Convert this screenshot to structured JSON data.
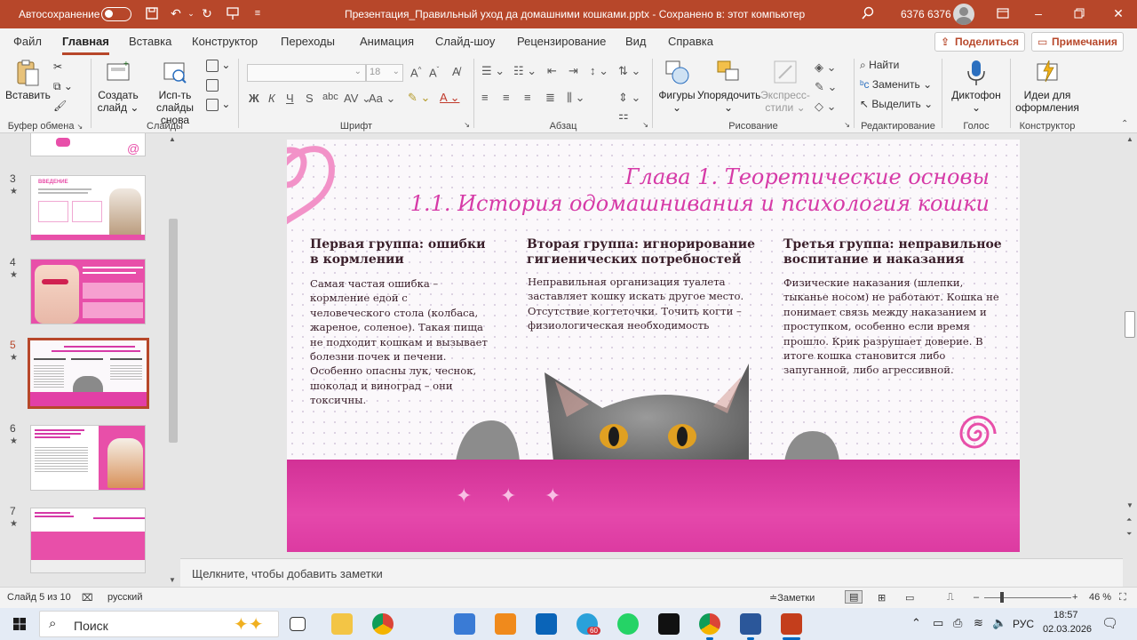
{
  "titlebar": {
    "autosave_label": "Автосохранение",
    "title": "Презентация_Правильный уход да домашними кошками.pptx  -  Сохранено в: этот компьютер ",
    "user_name": "6376 6376"
  },
  "tabs": [
    "Файл",
    "Главная",
    "Вставка",
    "Конструктор",
    "Переходы",
    "Анимация",
    "Слайд-шоу",
    "Рецензирование",
    "Вид",
    "Справка"
  ],
  "share": {
    "share_label": "Поделиться",
    "comments_label": "Примечания"
  },
  "ribbon": {
    "clipboard": {
      "paste": "Вставить",
      "group": "Буфер обмена"
    },
    "slides": {
      "new_slide_1": "Создать",
      "new_slide_2": "слайд",
      "reuse_1": "Исп-ть",
      "reuse_2": "слайды снова",
      "group": "Слайды"
    },
    "font": {
      "size": "18",
      "group": "Шрифт",
      "bold": "Ж",
      "italic": "К",
      "underline": "Ч",
      "strike": "S",
      "shadow": "abc"
    },
    "paragraph": {
      "group": "Абзац"
    },
    "drawing": {
      "shapes": "Фигуры",
      "arrange": "Упорядочить",
      "quick_1": "Экспресс-",
      "quick_2": "стили",
      "group": "Рисование"
    },
    "editing": {
      "find": "Найти",
      "replace": "Заменить",
      "select": "Выделить",
      "group": "Редактирование"
    },
    "voice": {
      "dictate": "Диктофон",
      "group": "Голос"
    },
    "designer": {
      "ideas_1": "Идеи для",
      "ideas_2": "оформления",
      "group": "Конструктор"
    }
  },
  "thumbnails": [
    {
      "num": "3",
      "star": "★"
    },
    {
      "num": "4",
      "star": "★"
    },
    {
      "num": "5",
      "star": "★"
    },
    {
      "num": "6",
      "star": "★"
    },
    {
      "num": "7",
      "star": "★"
    }
  ],
  "slide": {
    "title_line1": "Глава 1. Теоретические основы",
    "title_line2": "1.1. История одомашнивания и психология кошки",
    "col1": {
      "heading": "Первая группа: ошибки в кормлении",
      "text": "Самая частая ошибка – кормление едой с человеческого стола (колбаса, жареное, соленое). Такая пища не подходит кошкам и вызывает болезни почек и печени. Особенно опасны лук, чеснок, шоколад и виноград – они токсичны."
    },
    "col2": {
      "heading": "Вторая группа: игнорирование гигиенических потребностей",
      "text": "Неправильная организация туалета заставляет кошку искать другое место. Отсутствие когтеточки. Точить когти – физиологическая необходимость"
    },
    "col3": {
      "heading": "Третья группа: неправильное воспитание и наказания",
      "text": "Физические наказания (шлепки, тыканье носом) не работают. Кошка не понимает связь между наказанием и проступком, особенно если время прошло. Крик разрушает доверие. В итоге кошка становится либо запуганной, либо агрессивной."
    },
    "thumb3_title": "ВВЕДЕНИЕ"
  },
  "notes": {
    "placeholder": "Щелкните, чтобы добавить заметки"
  },
  "status": {
    "slide_of": "Слайд 5 из 10",
    "language": "русский",
    "notes": "Заметки",
    "zoom": "46 %"
  },
  "taskbar": {
    "search": "Поиск",
    "lang": "РУС",
    "time": "18:57",
    "date": "02.03.2026",
    "badge": "60"
  },
  "colors": {
    "accent": "#b7472a",
    "slide_pink": "#e23fa6",
    "title_pink": "#d63aa7"
  }
}
